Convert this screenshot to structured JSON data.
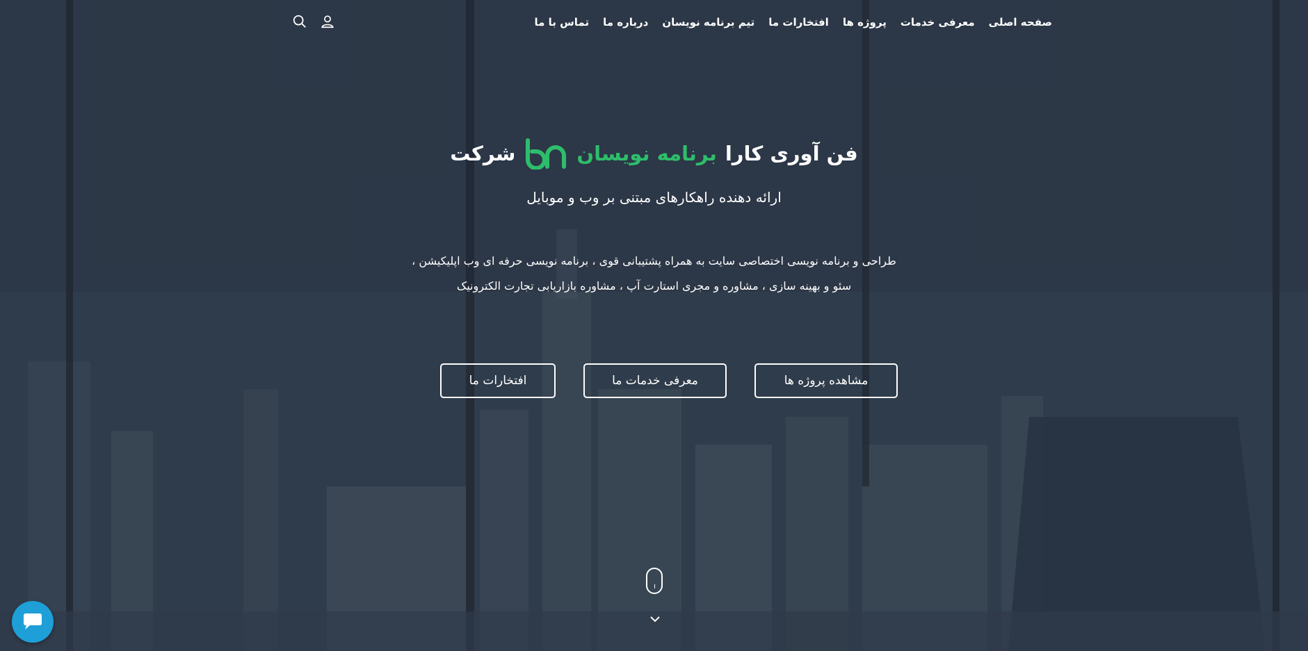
{
  "nav": {
    "items": [
      {
        "label": "صفحه اصلی"
      },
      {
        "label": "معرفی خدمات"
      },
      {
        "label": "پروژه ها"
      },
      {
        "label": "افتخارات ما"
      },
      {
        "label": "تیم برنامه نویسان"
      },
      {
        "label": "درباره ما"
      },
      {
        "label": "تماس با ما"
      }
    ],
    "icons": [
      "user-icon",
      "search-icon"
    ]
  },
  "hero": {
    "headline_prefix": "شرکت",
    "headline_brand": "برنامه نویسان",
    "headline_suffix": "فن آوری کارا",
    "logo_icon": "bn-logo-icon",
    "subtitle": "ارائه دهنده راهکارهای مبتنی بر وب و موبایل",
    "description_line1": "طراحی و برنامه نویسی اختصاصی سایت به همراه پشتیبانی قوی ، برنامه نویسی حرفه ای وب اپلیکیشن ،",
    "description_line2": "سئو و بهینه سازی ، مشاوره و مجری استارت آپ ، مشاوره بازاریابی تجارت الکترونیک"
  },
  "buttons": {
    "projects": "مشاهده پروژه ها",
    "services": "معرفی خدمات ما",
    "honors": "افتخارات ما"
  },
  "scroll": {
    "icons": [
      "mouse-scroll-icon",
      "chevron-down-icon"
    ]
  },
  "chat": {
    "icon": "chat-bubble-icon"
  },
  "colors": {
    "brand_green": "#2ebd6b",
    "chat_blue": "#1e9fd8",
    "text": "#ffffff",
    "background_overlay": "#2d3849"
  }
}
